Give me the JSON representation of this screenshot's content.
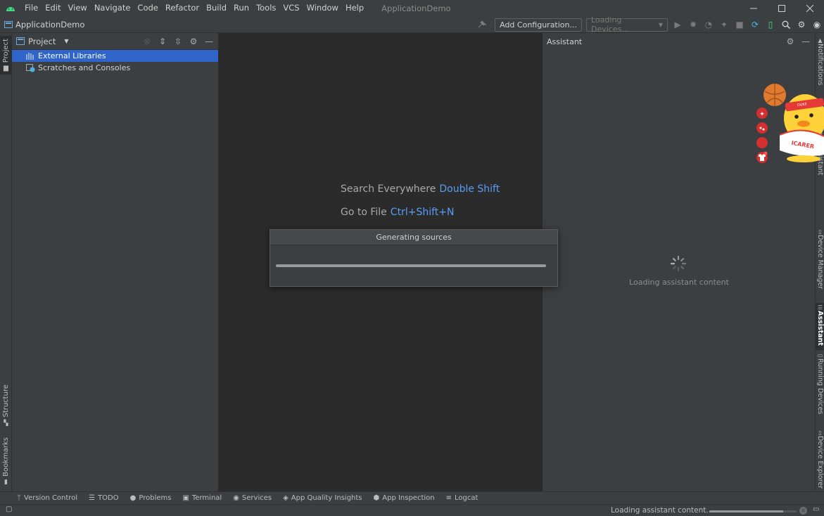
{
  "menubar": {
    "items": [
      "File",
      "Edit",
      "View",
      "Navigate",
      "Code",
      "Refactor",
      "Build",
      "Run",
      "Tools",
      "VCS",
      "Window",
      "Help"
    ],
    "window_title": "ApplicationDemo",
    "accent": "#3ddc84"
  },
  "toolbar": {
    "project_name": "ApplicationDemo",
    "add_configuration_label": "Add Configuration...",
    "devices_label": "Loading Devices..."
  },
  "left_stripe": {
    "project_tab": "Project",
    "structure_tab": "Structure",
    "bookmarks_tab": "Bookmarks"
  },
  "project_panel": {
    "title": "Project",
    "tree": [
      {
        "label": "External Libraries",
        "icon": "library-icon",
        "selected": true
      },
      {
        "label": "Scratches and Consoles",
        "icon": "scratches-icon",
        "selected": false
      }
    ]
  },
  "editor": {
    "hints": [
      {
        "text": "Search Everywhere",
        "key": "Double Shift"
      },
      {
        "text": "Go to File",
        "key": "Ctrl+Shift+N"
      }
    ]
  },
  "progress_dialog": {
    "title": "Generating sources",
    "progress": 1.0
  },
  "assistant_panel": {
    "title": "Assistant",
    "loading_text": "Loading assistant content"
  },
  "right_stripe": {
    "tabs": [
      "Notifications",
      "App Links Assistant",
      "Device Manager",
      "Assistant",
      "Running Devices",
      "Device Explorer"
    ],
    "active": "Assistant"
  },
  "mascot": {
    "shirt_text": "ICARER",
    "headband_text": "DUKE"
  },
  "bottom_tools": {
    "items": [
      {
        "label": "Version Control",
        "icon": "branch-icon"
      },
      {
        "label": "TODO",
        "icon": "list-icon"
      },
      {
        "label": "Problems",
        "icon": "problems-icon"
      },
      {
        "label": "Terminal",
        "icon": "terminal-icon"
      },
      {
        "label": "Services",
        "icon": "services-icon"
      },
      {
        "label": "App Quality Insights",
        "icon": "insights-icon"
      },
      {
        "label": "App Inspection",
        "icon": "inspection-icon"
      },
      {
        "label": "Logcat",
        "icon": "logcat-icon"
      }
    ]
  },
  "statusbar": {
    "text": "Loading assistant content...",
    "progress": 0.85
  }
}
